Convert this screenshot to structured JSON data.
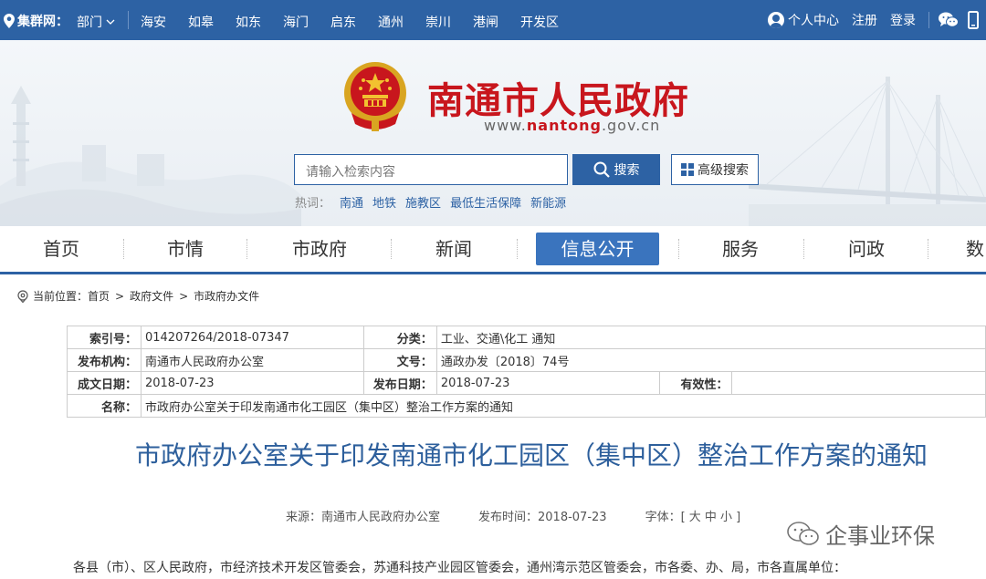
{
  "topbar": {
    "location_label": "集群网：",
    "dept_label": "部门",
    "cities": [
      "海安",
      "如皋",
      "如东",
      "海门",
      "启东",
      "通州",
      "崇川",
      "港闸",
      "开发区"
    ],
    "user_center": "个人中心",
    "register": "注册",
    "login": "登录"
  },
  "header": {
    "site_name": "南通市人民政府",
    "url_prefix": "www.",
    "url_domain": "nantong",
    "url_suffix": ".gov.cn",
    "search_placeholder": "请输入检索内容",
    "search_button": "搜索",
    "advanced_search": "高级搜索",
    "hot_label": "热词：",
    "hot_words": [
      "南通",
      "地铁",
      "施教区",
      "最低生活保障",
      "新能源"
    ]
  },
  "nav": {
    "items": [
      "首页",
      "市情",
      "市政府",
      "新闻",
      "信息公开",
      "服务",
      "问政",
      "数"
    ],
    "active": "信息公开"
  },
  "breadcrumb": {
    "label": "当前位置：",
    "items": [
      "首页",
      "政府文件",
      "市政府办文件"
    ]
  },
  "info": {
    "index_label": "索引号：",
    "index_value": "014207264/2018-07347",
    "category_label": "分类：",
    "category_value": "工业、交通\\化工    通知",
    "publisher_label": "发布机构：",
    "publisher_value": "南通市人民政府办公室",
    "doc_no_label": "文号：",
    "doc_no_value": "通政办发〔2018〕74号",
    "made_date_label": "成文日期：",
    "made_date_value": "2018-07-23",
    "pub_date_label": "发布日期：",
    "pub_date_value": "2018-07-23",
    "validity_label": "有效性：",
    "validity_value": "",
    "name_label": "名称：",
    "name_value": "市政府办公室关于印发南通市化工园区（集中区）整治工作方案的通知"
  },
  "article": {
    "title": "市政府办公室关于印发南通市化工园区（集中区）整治工作方案的通知",
    "source": "来源：南通市人民政府办公室",
    "pub_time": "发布时间：2018-07-23",
    "font_size": "字体：[ 大 中 小 ]",
    "watermark": "企事业环保",
    "first_line": "各县（市）、区人民政府，市经济技术开发区管委会，苏通科技产业园区管委会，通州湾示范区管委会，市各委、办、局，市各直属单位："
  },
  "colors": {
    "topbar": "#2d62a4",
    "brand_red": "#c8161d",
    "nav_active": "#3a74be",
    "title_blue": "#2d5f9c"
  }
}
